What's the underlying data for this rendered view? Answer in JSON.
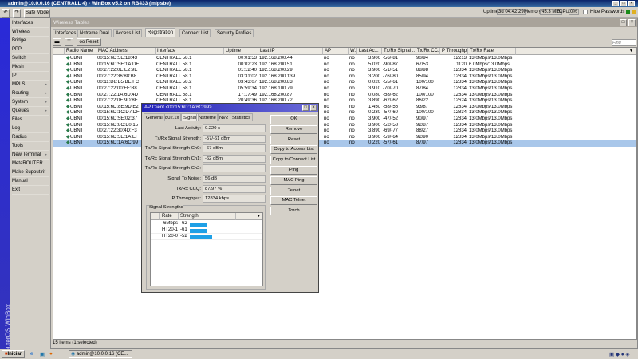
{
  "window": {
    "title": "admin@10.0.0.16 (CENTRALL 4) - WinBox v5.2 on RB433 (mipsbe)"
  },
  "toolbar": {
    "undo_icon": "undo-icon",
    "redo_icon": "redo-icon",
    "safe_mode": "Safe Mode",
    "uptime_label": "Uptime:",
    "uptime": "3d 04:42:29",
    "memory_label": "Memory:",
    "memory": "45.3 MiB",
    "cpu_label": "CPU:",
    "cpu": "0%",
    "hide_passwords": "Hide Passwords"
  },
  "sidebar": {
    "brand": "RouterOS WinBox",
    "items": [
      {
        "label": "Interfaces"
      },
      {
        "label": "Wireless"
      },
      {
        "label": "Bridge"
      },
      {
        "label": "PPP"
      },
      {
        "label": "Switch"
      },
      {
        "label": "Mesh"
      },
      {
        "label": "IP",
        "submenu": true
      },
      {
        "label": "MPLS",
        "submenu": true
      },
      {
        "label": "Routing",
        "submenu": true
      },
      {
        "label": "System",
        "submenu": true
      },
      {
        "label": "Queues"
      },
      {
        "label": "Files"
      },
      {
        "label": "Log"
      },
      {
        "label": "Radius"
      },
      {
        "label": "Tools",
        "submenu": true
      },
      {
        "label": "New Terminal"
      },
      {
        "label": "MetaROUTER"
      },
      {
        "label": "Make Supout.rif"
      },
      {
        "label": "Manual"
      },
      {
        "label": "Exit"
      }
    ]
  },
  "wireless": {
    "title": "Wireless Tables",
    "tabs": [
      "Interfaces",
      "Nstreme Dual",
      "Access List",
      "Registration",
      "Connect List",
      "Security Profiles"
    ],
    "active_tab": "Registration",
    "reset": "Reset",
    "find_placeholder": "Find",
    "columns": [
      "Radio Name",
      "MAC Address",
      "Interface",
      "Uptime",
      "Last IP",
      "AP",
      "W...",
      "Last Ac...",
      "Tx/Rx Signal ...",
      "Tx/Rx CC...",
      "P Throughp...",
      "Tx/Rx Rate"
    ],
    "rows": [
      [
        "UBNT",
        "00:15:6D:5E:18:43",
        "CENTRALL 58.1",
        "00:01:53",
        "192.168.200.44",
        "no",
        "no",
        "3.900",
        "-56/-81",
        "90/94",
        "12213",
        "13.0Mbps/13.0Mbps"
      ],
      [
        "UBNT",
        "00:15:6D:5E:1A:DE",
        "CENTRALL 58.1",
        "00:02:23",
        "192.168.200.51",
        "no",
        "no",
        "5.020",
        "-90/-87",
        "67/53",
        "1120",
        "6.0Mbps/13.0Mbps"
      ],
      [
        "UBNT",
        "00:27:22:0E:E2:9E",
        "CENTRALL 58.1",
        "01:12:40",
        "192.168.200.29",
        "no",
        "no",
        "3.900",
        "-51/-51",
        "88/98",
        "12834",
        "13.0Mbps/13.0Mbps"
      ],
      [
        "UBNT",
        "00:27:22:36:88:B8",
        "CENTRALL 58.1",
        "03:31:02",
        "192.168.200.139",
        "no",
        "no",
        "3.200",
        "-76/-80",
        "85/94",
        "12834",
        "13.0Mbps/13.0Mbps"
      ],
      [
        "UBNT",
        "00:11:D8:B5:BE:FC",
        "CENTRALL 58.2",
        "03:43:07",
        "192.168.200.83",
        "no",
        "no",
        "0.020",
        "-55/-61",
        "100/100",
        "12834",
        "13.0Mbps/13.0Mbps"
      ],
      [
        "UBNT",
        "00:27:22:00:FF:B8",
        "CENTRALL 58.1",
        "05:59:34",
        "192.168.100.79",
        "no",
        "no",
        "3.910",
        "-70/-70",
        "87/84",
        "12834",
        "13.0Mbps/13.0Mbps"
      ],
      [
        "UBNT",
        "00:27:22:1A:6D:4D",
        "CENTRALL 58.1",
        "17:17:49",
        "192.168.200.87",
        "no",
        "no",
        "0.080",
        "-58/-62",
        "100/100",
        "12834",
        "13.0Mbps/13.0Mbps"
      ],
      [
        "UBNT",
        "00:27:22:0E:9D:8E",
        "CENTRALL 58.1",
        "20:49:36",
        "192.168.200.72",
        "no",
        "no",
        "3.890",
        "-62/-62",
        "86/22",
        "12624",
        "13.0Mbps/13.0Mbps"
      ],
      [
        "UBNT",
        "00:15:6D:8E:9D:E2",
        "",
        "",
        "",
        "no",
        "no",
        "1.450",
        "-58/-56",
        "93/87",
        "12834",
        "13.0Mbps/13.0Mbps"
      ],
      [
        "UBNT",
        "00:15:6D:1C:D7:DF",
        "",
        "",
        "",
        "no",
        "no",
        "0.230",
        "-57/-60",
        "100/100",
        "12834",
        "13.0Mbps/13.0Mbps"
      ],
      [
        "UBNT",
        "00:15:6D:5E:02:37",
        "",
        "",
        "",
        "no",
        "no",
        "3.900",
        "-47/-52",
        "90/97",
        "12834",
        "13.0Mbps/13.0Mbps"
      ],
      [
        "UBNT",
        "00:15:6D:8C:E0:15",
        "",
        "",
        "",
        "no",
        "no",
        "3.900",
        "-52/-58",
        "92/87",
        "12834",
        "13.0Mbps/13.0Mbps"
      ],
      [
        "UBNT",
        "00:27:22:30:4D:F3",
        "",
        "",
        "",
        "no",
        "no",
        "3.890",
        "-69/-77",
        "88/27",
        "12834",
        "13.0Mbps/13.0Mbps"
      ],
      [
        "UBNT",
        "00:15:6D:5E:1A:EF",
        "",
        "",
        "",
        "no",
        "no",
        "3.900",
        "-59/-64",
        "92/90",
        "12834",
        "13.0Mbps/13.0Mbps"
      ],
      [
        "UBNT",
        "00:15:6D:1A:6C:99",
        "",
        "",
        "",
        "no",
        "no",
        "0.220",
        "-57/-61",
        "87/97",
        "12834",
        "13.0Mbps/13.0Mbps"
      ]
    ],
    "selected_row": 14,
    "status": "15 items (1 selected)"
  },
  "dialog": {
    "title": "AP Client <00:15:6D:1A:6C:99>",
    "tabs": [
      "General",
      "802.1x",
      "Signal",
      "Nstreme",
      "NV2",
      "Statistics"
    ],
    "active_tab": "Signal",
    "fields": [
      {
        "label": "Last Activity:",
        "value": "0.220 s"
      },
      {
        "label": "Tx/Rx Signal Strength:",
        "value": "-57/-61 dBm"
      },
      {
        "label": "Tx/Rx Signal Strength Ch0:",
        "value": "-67 dBm"
      },
      {
        "label": "Tx/Rx Signal Strength Ch1:",
        "value": "-62 dBm"
      },
      {
        "label": "Tx/Rx Signal Strength Ch2:",
        "value": ""
      },
      {
        "label": "Signal To Noise:",
        "value": "56 dB"
      },
      {
        "label": "Tx/Rx CCQ:",
        "value": "87/97 %"
      },
      {
        "label": "P Throughput:",
        "value": "12834 kbps"
      }
    ],
    "buttons": [
      "OK",
      "Remove",
      "Reset",
      "Copy to Access List",
      "Copy to Connect List",
      "Ping",
      "MAC Ping",
      "Telnet",
      "MAC Telnet",
      "Torch"
    ],
    "signal_group": "Signal Strengths",
    "signal_columns": [
      "Rate",
      "Strength"
    ],
    "signals": [
      {
        "rate": "6Mbps",
        "strength": "-62",
        "level": -62
      },
      {
        "rate": "HT20-1",
        "strength": "-61",
        "level": -61
      },
      {
        "rate": "HT20-0",
        "strength": "-52",
        "level": -52
      }
    ]
  },
  "taskbar": {
    "start": "Iniciar",
    "task": "admin@10.0.0.16 (CE..."
  },
  "colors": {
    "title_bar": "#0a246a",
    "sidebar_strip": "#2a2ad8",
    "selected_row": "#a9c7ea",
    "signal_bar": "#1ea0e6"
  }
}
